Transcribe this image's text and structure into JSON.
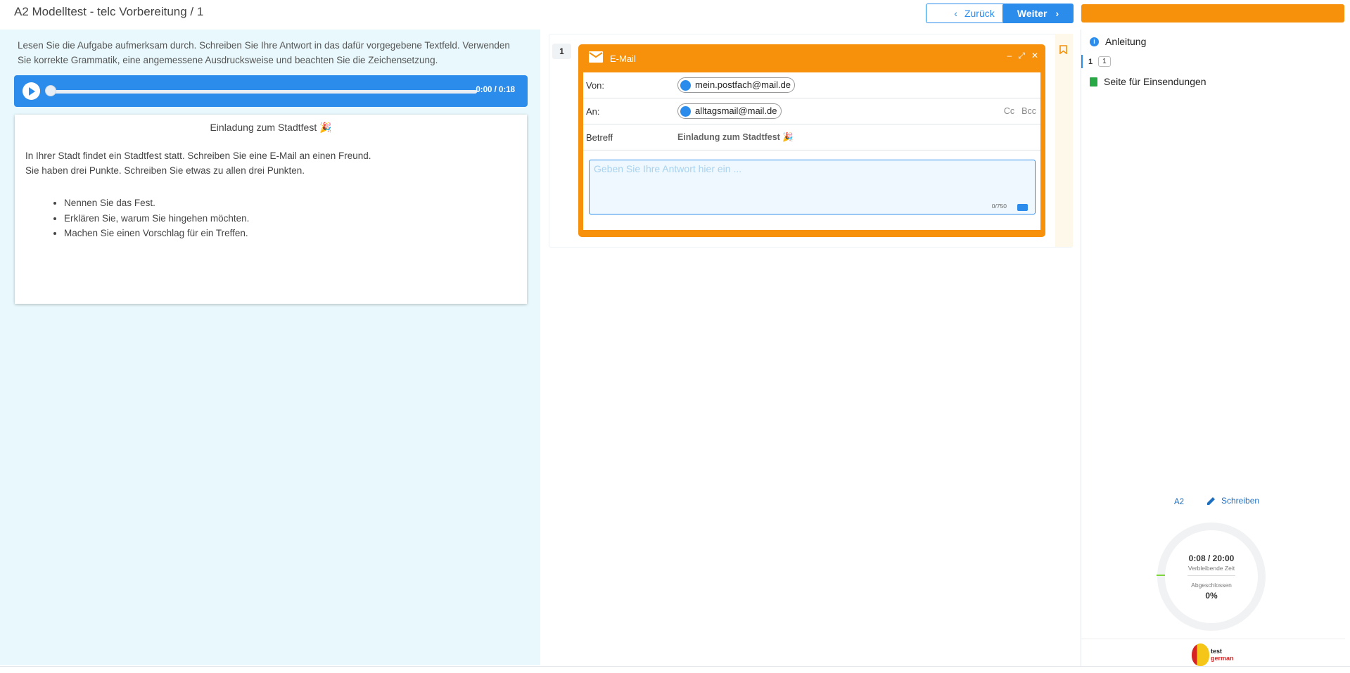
{
  "header": {
    "title": "A2 Modelltest - telc Vorbereitung / 1",
    "back_label": "Zurück",
    "next_label": "Weiter"
  },
  "left": {
    "instructions": "Lesen Sie die Aufgabe aufmerksam durch. Schreiben Sie Ihre Antwort in das dafür vorgegebene Textfeld. Verwenden Sie korrekte Grammatik, eine angemessene Ausdrucksweise und beachten Sie die Zeichensetzung.",
    "audio": {
      "time": "0:00 / 0:18",
      "progress": 0
    },
    "task": {
      "title": "Einladung zum Stadtfest 🎉",
      "line1": "In Ihrer Stadt findet ein Stadtfest statt. Schreiben Sie eine E-Mail an einen Freund.",
      "line2": "Sie haben drei Punkte. Schreiben Sie etwas zu allen drei Punkten.",
      "points": [
        "Nennen Sie das Fest.",
        "Erklären Sie, warum Sie hingehen möchten.",
        "Machen Sie einen Vorschlag für ein Treffen."
      ]
    }
  },
  "email": {
    "question_number": "1",
    "window_title": "E-Mail",
    "from_label": "Von:",
    "from_value": "mein.postfach@mail.de",
    "to_label": "An:",
    "to_value": "alltagsmail@mail.de",
    "cc_label": "Cc",
    "bcc_label": "Bcc",
    "subject_label": "Betreff",
    "subject_value": "Einladung zum Stadtfest 🎉",
    "answer_placeholder": "Geben Sie Ihre Antwort hier ein ...",
    "char_count": "0/750"
  },
  "sidebar": {
    "instructions_label": "Anleitung",
    "question_index": "1",
    "question_box": "1",
    "submissions_label": "Seite für Einsendungen",
    "level": "A2",
    "skill": "Schreiben",
    "timer": {
      "time": "0:08 / 20:00",
      "remaining_label": "Verbleibende Zeit",
      "completed_label": "Abgeschlossen",
      "completed_value": "0%"
    },
    "logo_line1": "test",
    "logo_line2": "german"
  },
  "colors": {
    "accent_blue": "#2b8ceb",
    "accent_orange": "#f7900a",
    "panel_bg": "#e8f8fc"
  }
}
